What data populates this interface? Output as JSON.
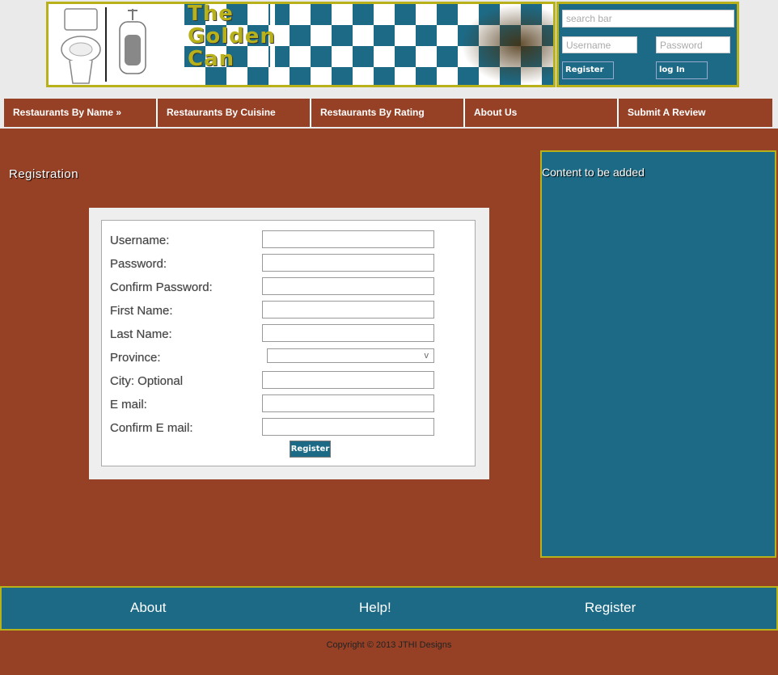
{
  "header": {
    "title_lines": [
      "The",
      "Golden",
      "Can"
    ]
  },
  "login_panel": {
    "search_placeholder": "search bar",
    "username_placeholder": "Username",
    "password_placeholder": "Password",
    "register_label": "Register",
    "login_label": "log In"
  },
  "nav": {
    "items": [
      {
        "label": "Restaurants By Name »"
      },
      {
        "label": "Restaurants By Cuisine"
      },
      {
        "label": "Restaurants By Rating"
      },
      {
        "label": "About Us"
      },
      {
        "label": "Submit A Review"
      }
    ]
  },
  "main": {
    "heading": "Registration",
    "form": {
      "labels": {
        "username": "Username:",
        "password": "Password:",
        "confirm_password": "Confirm Password:",
        "first_name": "First Name:",
        "last_name": "Last Name:",
        "province": "Province:",
        "city": "City: Optional",
        "email": "E mail:",
        "confirm_email": "Confirm E mail:"
      },
      "province_value": "",
      "submit_label": "Register"
    }
  },
  "sidebar": {
    "text": "Content to be added"
  },
  "footer": {
    "links": [
      "About",
      "Help!",
      "Register"
    ],
    "copyright": "Copyright © 2013 JTHI Designs"
  },
  "colors": {
    "brown": "#964126",
    "teal": "#1d6a86",
    "gold": "#b9b11a"
  }
}
